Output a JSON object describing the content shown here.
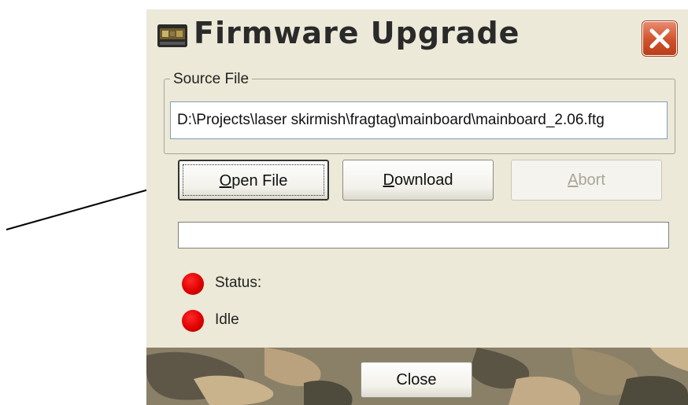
{
  "window": {
    "title": "Firmware Upgrade"
  },
  "source_file": {
    "group_label": "Source File",
    "path_value": "D:\\Projects\\laser skirmish\\fragtag\\mainboard\\mainboard_2.06.ftg"
  },
  "buttons": {
    "open_file": {
      "mnemonic": "O",
      "rest": "pen File"
    },
    "download": {
      "mnemonic": "D",
      "rest": "ownload"
    },
    "abort": {
      "mnemonic": "A",
      "rest": "bort",
      "enabled": false
    },
    "close": "Close"
  },
  "progress": {
    "fraction": 0
  },
  "status": {
    "label": "Status:",
    "value": "Idle",
    "led_color": "#e00000"
  },
  "colors": {
    "dialog_background": "#ece9d8",
    "close_button_red": "#d0512b",
    "led_red": "#e00000"
  },
  "icons": {
    "app": "firmware-chip-icon",
    "close": "close-x-icon",
    "annotation": "pointer-arrow-icon"
  }
}
